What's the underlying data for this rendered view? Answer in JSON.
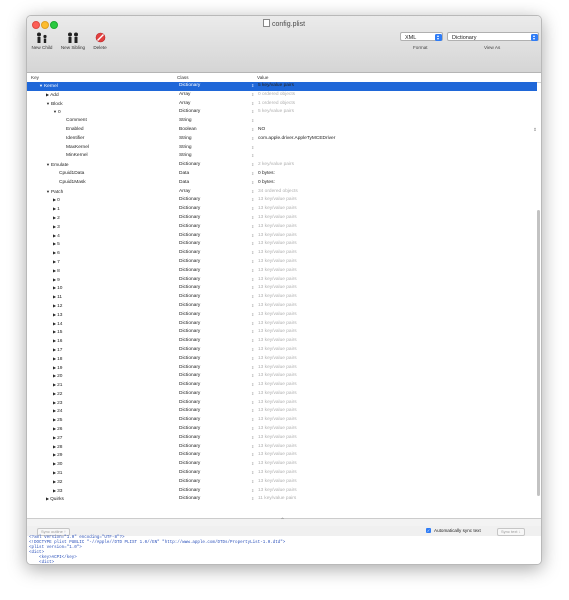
{
  "window": {
    "title": "config.plist"
  },
  "toolbar": {
    "new_child": "New Child",
    "new_sibling": "New Sibling",
    "delete": "Delete",
    "format_value": "XML",
    "format_label": "Format",
    "view_value": "Dictionary",
    "view_label": "View As"
  },
  "columns": {
    "key": "Key",
    "class": "Class",
    "value": "Value"
  },
  "rows": [
    {
      "key": "Kernel",
      "class": "Dictionary",
      "value": "5 key/value pairs",
      "indent": 0,
      "disc": "down",
      "sel": true,
      "normal": true
    },
    {
      "key": "Add",
      "class": "Array",
      "value": "0 ordered objects",
      "indent": 1,
      "disc": "right"
    },
    {
      "key": "Block",
      "class": "Array",
      "value": "1 ordered objects",
      "indent": 1,
      "disc": "down"
    },
    {
      "key": "0",
      "class": "Dictionary",
      "value": "5 key/value pairs",
      "indent": 2,
      "disc": "down"
    },
    {
      "key": "Comment",
      "class": "String",
      "value": "",
      "indent": 3
    },
    {
      "key": "Enabled",
      "class": "Boolean",
      "value": "NO",
      "indent": 3,
      "normal": true,
      "bool": true
    },
    {
      "key": "Identifier",
      "class": "String",
      "value": "com.apple.driver.AppleTyMCEDriver",
      "indent": 3,
      "normal": true
    },
    {
      "key": "MaxKernel",
      "class": "String",
      "value": "",
      "indent": 3
    },
    {
      "key": "MinKernel",
      "class": "String",
      "value": "",
      "indent": 3
    },
    {
      "key": "Emulate",
      "class": "Dictionary",
      "value": "2 key/value pairs",
      "indent": 1,
      "disc": "down"
    },
    {
      "key": "Cpuid1Data",
      "class": "Data",
      "value": "0 bytes:",
      "indent": 2,
      "normal": true
    },
    {
      "key": "Cpuid1Mask",
      "class": "Data",
      "value": "0 bytes:",
      "indent": 2,
      "normal": true
    },
    {
      "key": "Patch",
      "class": "Array",
      "value": "34 ordered objects",
      "indent": 1,
      "disc": "down"
    },
    {
      "key": "0",
      "class": "Dictionary",
      "value": "13 key/value pairs",
      "indent": 2,
      "disc": "right"
    },
    {
      "key": "1",
      "class": "Dictionary",
      "value": "13 key/value pairs",
      "indent": 2,
      "disc": "right"
    },
    {
      "key": "2",
      "class": "Dictionary",
      "value": "13 key/value pairs",
      "indent": 2,
      "disc": "right"
    },
    {
      "key": "3",
      "class": "Dictionary",
      "value": "13 key/value pairs",
      "indent": 2,
      "disc": "right"
    },
    {
      "key": "4",
      "class": "Dictionary",
      "value": "13 key/value pairs",
      "indent": 2,
      "disc": "right"
    },
    {
      "key": "5",
      "class": "Dictionary",
      "value": "13 key/value pairs",
      "indent": 2,
      "disc": "right"
    },
    {
      "key": "6",
      "class": "Dictionary",
      "value": "13 key/value pairs",
      "indent": 2,
      "disc": "right"
    },
    {
      "key": "7",
      "class": "Dictionary",
      "value": "13 key/value pairs",
      "indent": 2,
      "disc": "right"
    },
    {
      "key": "8",
      "class": "Dictionary",
      "value": "13 key/value pairs",
      "indent": 2,
      "disc": "right"
    },
    {
      "key": "9",
      "class": "Dictionary",
      "value": "13 key/value pairs",
      "indent": 2,
      "disc": "right"
    },
    {
      "key": "10",
      "class": "Dictionary",
      "value": "13 key/value pairs",
      "indent": 2,
      "disc": "right"
    },
    {
      "key": "11",
      "class": "Dictionary",
      "value": "13 key/value pairs",
      "indent": 2,
      "disc": "right"
    },
    {
      "key": "12",
      "class": "Dictionary",
      "value": "13 key/value pairs",
      "indent": 2,
      "disc": "right"
    },
    {
      "key": "13",
      "class": "Dictionary",
      "value": "13 key/value pairs",
      "indent": 2,
      "disc": "right"
    },
    {
      "key": "14",
      "class": "Dictionary",
      "value": "13 key/value pairs",
      "indent": 2,
      "disc": "right"
    },
    {
      "key": "15",
      "class": "Dictionary",
      "value": "13 key/value pairs",
      "indent": 2,
      "disc": "right"
    },
    {
      "key": "16",
      "class": "Dictionary",
      "value": "13 key/value pairs",
      "indent": 2,
      "disc": "right"
    },
    {
      "key": "17",
      "class": "Dictionary",
      "value": "13 key/value pairs",
      "indent": 2,
      "disc": "right"
    },
    {
      "key": "18",
      "class": "Dictionary",
      "value": "13 key/value pairs",
      "indent": 2,
      "disc": "right"
    },
    {
      "key": "19",
      "class": "Dictionary",
      "value": "13 key/value pairs",
      "indent": 2,
      "disc": "right"
    },
    {
      "key": "20",
      "class": "Dictionary",
      "value": "13 key/value pairs",
      "indent": 2,
      "disc": "right"
    },
    {
      "key": "21",
      "class": "Dictionary",
      "value": "13 key/value pairs",
      "indent": 2,
      "disc": "right"
    },
    {
      "key": "22",
      "class": "Dictionary",
      "value": "13 key/value pairs",
      "indent": 2,
      "disc": "right"
    },
    {
      "key": "23",
      "class": "Dictionary",
      "value": "13 key/value pairs",
      "indent": 2,
      "disc": "right"
    },
    {
      "key": "24",
      "class": "Dictionary",
      "value": "13 key/value pairs",
      "indent": 2,
      "disc": "right"
    },
    {
      "key": "25",
      "class": "Dictionary",
      "value": "13 key/value pairs",
      "indent": 2,
      "disc": "right"
    },
    {
      "key": "26",
      "class": "Dictionary",
      "value": "13 key/value pairs",
      "indent": 2,
      "disc": "right"
    },
    {
      "key": "27",
      "class": "Dictionary",
      "value": "13 key/value pairs",
      "indent": 2,
      "disc": "right"
    },
    {
      "key": "28",
      "class": "Dictionary",
      "value": "13 key/value pairs",
      "indent": 2,
      "disc": "right"
    },
    {
      "key": "29",
      "class": "Dictionary",
      "value": "13 key/value pairs",
      "indent": 2,
      "disc": "right"
    },
    {
      "key": "30",
      "class": "Dictionary",
      "value": "13 key/value pairs",
      "indent": 2,
      "disc": "right"
    },
    {
      "key": "31",
      "class": "Dictionary",
      "value": "13 key/value pairs",
      "indent": 2,
      "disc": "right"
    },
    {
      "key": "32",
      "class": "Dictionary",
      "value": "13 key/value pairs",
      "indent": 2,
      "disc": "right"
    },
    {
      "key": "33",
      "class": "Dictionary",
      "value": "13 key/value pairs",
      "indent": 2,
      "disc": "right"
    },
    {
      "key": "Quirks",
      "class": "Dictionary",
      "value": "11 key/value pairs",
      "indent": 1,
      "disc": "right"
    }
  ],
  "sync": {
    "outline_button": "Sync outline ↑",
    "auto_label": "Automatically sync text",
    "auto_checked": true,
    "text_button": "Sync text ↓"
  },
  "xml_lines": [
    "<?xml version=\"1.0\" encoding=\"UTF-8\"?>",
    "<!DOCTYPE plist PUBLIC \"-//Apple//DTD PLIST 1.0//EN\" \"http://www.apple.com/DTDs/PropertyList-1.0.dtd\">",
    "<plist version=\"1.0\">",
    "<dict>",
    "    <key>ACPI</key>",
    "    <dict>",
    "        <key>Add</key>",
    "        <array>"
  ],
  "colors": {
    "selection": "#1f67d8",
    "accent": "#2f7cf6",
    "muted_value": "#b0b0b0"
  }
}
